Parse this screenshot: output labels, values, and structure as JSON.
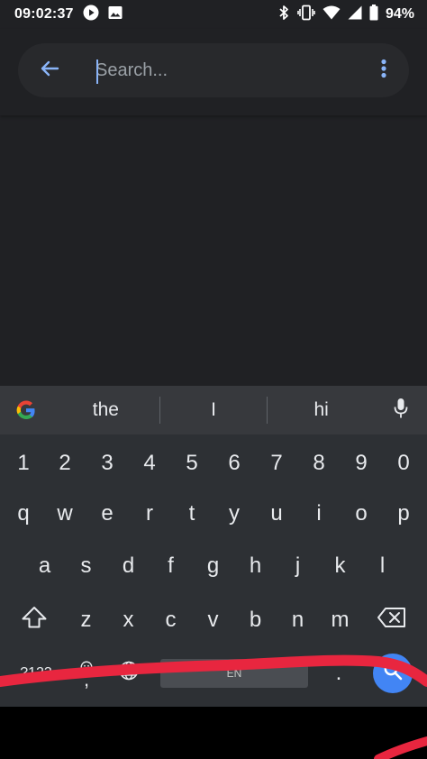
{
  "status_bar": {
    "time": "09:02:37",
    "battery_pct": "94%"
  },
  "search": {
    "placeholder": "Search...",
    "value": ""
  },
  "keyboard": {
    "suggestions": [
      "the",
      "I",
      "hi"
    ],
    "row_numbers": [
      "1",
      "2",
      "3",
      "4",
      "5",
      "6",
      "7",
      "8",
      "9",
      "0"
    ],
    "row_1": [
      "q",
      "w",
      "e",
      "r",
      "t",
      "y",
      "u",
      "i",
      "o",
      "p"
    ],
    "row_2": [
      "a",
      "s",
      "d",
      "f",
      "g",
      "h",
      "j",
      "k",
      "l"
    ],
    "row_3": [
      "z",
      "x",
      "c",
      "v",
      "b",
      "n",
      "m"
    ],
    "symbols_label": "?123",
    "comma_label": ",",
    "period_label": ".",
    "space_label": "EN"
  },
  "colors": {
    "background": "#202124",
    "accent": "#8ab4f8",
    "keyboard_bg": "#2d3034",
    "search_key": "#4285f4",
    "red_annotation": "#e8263f"
  }
}
